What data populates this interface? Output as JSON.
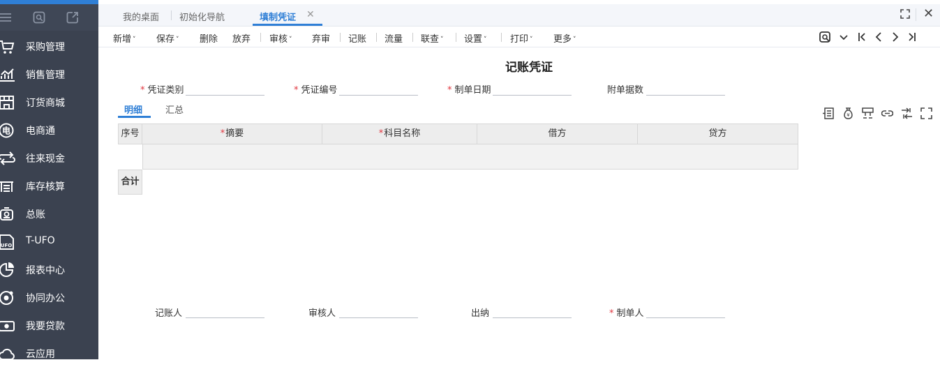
{
  "sidebar": {
    "top_icons": [
      "menu-icon",
      "search-app-icon",
      "add-window-icon"
    ],
    "items": [
      {
        "label": "采购管理",
        "icon": "cart-icon"
      },
      {
        "label": "销售管理",
        "icon": "sales-chart-icon"
      },
      {
        "label": "订货商城",
        "icon": "store-icon"
      },
      {
        "label": "电商通",
        "icon": "ecommerce-icon"
      },
      {
        "label": "往来现金",
        "icon": "transfer-icon"
      },
      {
        "label": "库存核算",
        "icon": "warehouse-icon"
      },
      {
        "label": "总账",
        "icon": "ledger-icon"
      },
      {
        "label": "T-UFO",
        "icon": "ufo-icon"
      },
      {
        "label": "报表中心",
        "icon": "pie-chart-icon"
      },
      {
        "label": "协同办公",
        "icon": "collab-icon"
      },
      {
        "label": "我要贷款",
        "icon": "loan-icon"
      },
      {
        "label": "云应用",
        "icon": "cloud-icon"
      }
    ]
  },
  "tabs": {
    "items": [
      {
        "label": "我的桌面"
      },
      {
        "label": "初始化导航"
      },
      {
        "label": "填制凭证"
      }
    ],
    "close_glyph": "✕"
  },
  "toolbar": {
    "buttons": [
      {
        "label": "新增",
        "has_dropdown": true
      },
      {
        "label": "保存",
        "has_dropdown": true
      },
      {
        "label": "删除",
        "has_dropdown": false
      },
      {
        "label": "放弃",
        "has_dropdown": false
      },
      {
        "label": "审核",
        "has_dropdown": true
      },
      {
        "label": "弃审",
        "has_dropdown": false
      },
      {
        "label": "记账",
        "has_dropdown": false
      },
      {
        "label": "流量",
        "has_dropdown": false
      },
      {
        "label": "联查",
        "has_dropdown": true
      },
      {
        "label": "设置",
        "has_dropdown": true
      },
      {
        "label": "打印",
        "has_dropdown": true
      },
      {
        "label": "更多",
        "has_dropdown": true
      }
    ],
    "caret": "˅",
    "nav_icons": [
      "search-voucher-icon",
      "dropdown-icon",
      "first-record-icon",
      "prev-record-icon",
      "next-record-icon",
      "last-record-icon"
    ]
  },
  "voucher": {
    "title": "记账凭证",
    "fields": [
      {
        "label": "凭证类别",
        "required": true,
        "value": ""
      },
      {
        "label": "凭证编号",
        "required": true,
        "value": ""
      },
      {
        "label": "制单日期",
        "required": true,
        "value": ""
      },
      {
        "label": "附单据数",
        "required": false,
        "value": ""
      }
    ],
    "detail_tabs": [
      {
        "label": "明细",
        "active": true
      },
      {
        "label": "汇总",
        "active": false
      }
    ],
    "side_icons": [
      "insert-row-icon",
      "money-bag-icon",
      "split-icon",
      "link-icon",
      "balance-icon",
      "fullscreen-icon"
    ],
    "grid": {
      "columns": [
        {
          "label": "序号",
          "required": false
        },
        {
          "label": "摘要",
          "required": true
        },
        {
          "label": "科目名称",
          "required": true
        },
        {
          "label": "借方",
          "required": false
        },
        {
          "label": "贷方",
          "required": false
        }
      ],
      "total_label": "合计"
    },
    "signatures": [
      {
        "label": "记账人",
        "required": false,
        "value": ""
      },
      {
        "label": "审核人",
        "required": false,
        "value": ""
      },
      {
        "label": "出纳",
        "required": false,
        "value": ""
      },
      {
        "label": "制单人",
        "required": true,
        "value": ""
      }
    ]
  },
  "colors": {
    "sidebar_bg": "#3b4250",
    "accent": "#2f7fd6",
    "required": "#e0353e"
  }
}
